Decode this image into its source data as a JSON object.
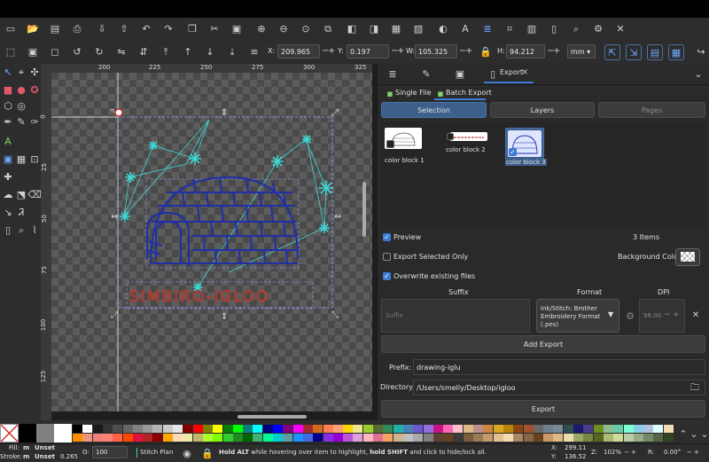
{
  "controls": {
    "x_label": "X:",
    "x_value": "209.965",
    "y_label": "Y:",
    "y_value": "0.197",
    "w_label": "W:",
    "w_value": "105.325",
    "h_label": "H:",
    "h_value": "94.212",
    "unit": "mm",
    "plus": "+",
    "minus": "−"
  },
  "ruler": {
    "h_ticks": [
      "200",
      "225",
      "250",
      "275",
      "300",
      "325"
    ],
    "v_ticks": [
      "0",
      "25",
      "50",
      "75",
      "100",
      "125"
    ]
  },
  "canvas": {
    "logo_text": "SIMBIRO-IGLOO"
  },
  "panel": {
    "tab_export": "Export",
    "tab_close": "×",
    "single_file": "Single File",
    "batch_export": "Batch Export",
    "seg_selection": "Selection",
    "seg_layers": "Layers",
    "seg_pages": "Pages",
    "items": [
      {
        "label": "color block 1"
      },
      {
        "label": "color block 2"
      },
      {
        "label": "color block 3"
      }
    ],
    "preview_label": "Preview",
    "items_count": "3 Items",
    "export_selected_label": "Export Selected Only",
    "background_color_label": "Background Color",
    "overwrite_label": "Overwrite existing files",
    "col_suffix": "Suffix",
    "col_format": "Format",
    "col_dpi": "DPI",
    "suffix_placeholder": "Suffix",
    "format_value": "Ink/Stitch: Brother Embroidery Format (.pes)",
    "dpi_value": "96.00",
    "add_export": "Add Export",
    "prefix_label": "Prefix:",
    "prefix_value": "drawing-iglu",
    "directory_label": "Directory:",
    "directory_value": "/Users/smelly/Desktop/igloo",
    "export_button": "Export"
  },
  "status": {
    "fill_label": "Fill:",
    "fill_m": "m",
    "fill_value": "Unset",
    "stroke_label": "Stroke:",
    "stroke_m": "m",
    "stroke_value": "Unset",
    "stroke_width": "0.265",
    "opacity_label": "O:",
    "opacity_value": "100",
    "layer_name": "Stitch Plan",
    "hint_bold1": "Hold ALT",
    "hint_mid": " while hovering over item to highlight, ",
    "hint_bold2": "hold SHIFT",
    "hint_end": " and click to hide/lock all.",
    "x_label": "X:",
    "x_value": "299.11",
    "y_label": "Y:",
    "y_value": "136.52",
    "zoom_label": "Z:",
    "zoom_value": "102%",
    "rot_label": "R:",
    "rot_value": "0.00°"
  },
  "colors": {
    "accent": "#3d5f8c",
    "igloo_stroke": "#1f2fa8",
    "snow_stroke": "#3fd6d6",
    "text_red": "#c0392b"
  },
  "palette_row1": [
    "#000000",
    "#ffffff",
    "#1a1a1a",
    "#333333",
    "#4d4d4d",
    "#666666",
    "#808080",
    "#999999",
    "#b3b3b3",
    "#cccccc",
    "#e6e6e6",
    "#800000",
    "#ff0000",
    "#808000",
    "#ffff00",
    "#008000",
    "#00ff00",
    "#008080",
    "#00ffff",
    "#000080",
    "#0000ff",
    "#800080",
    "#ff00ff",
    "#a52a2a",
    "#d2691e",
    "#ff7f50",
    "#ffa07a",
    "#ffd700",
    "#f0e68c",
    "#9acd32",
    "#556b2f",
    "#2e8b57",
    "#20b2aa",
    "#4682b4",
    "#6a5acd",
    "#9370db",
    "#c71585",
    "#ff69b4",
    "#ffc0cb",
    "#deb887",
    "#bc8f8f",
    "#cd853f",
    "#daa520",
    "#b8860b",
    "#8b4513",
    "#a0522d",
    "#696969",
    "#708090",
    "#778899",
    "#2f4f4f",
    "#191970",
    "#483d8b",
    "#6b8e23",
    "#8fbc8f",
    "#66cdaa",
    "#7fffd4",
    "#87ceeb",
    "#b0c4de",
    "#e0ffff",
    "#f5deb3"
  ],
  "palette_row2": [
    "#ff8c00",
    "#e9967a",
    "#f08080",
    "#fa8072",
    "#ff6347",
    "#ff4500",
    "#dc143c",
    "#b22222",
    "#8b0000",
    "#ffa500",
    "#ffdab9",
    "#eee8aa",
    "#bdb76b",
    "#adff2f",
    "#7cfc00",
    "#32cd32",
    "#228b22",
    "#006400",
    "#3cb371",
    "#00fa9a",
    "#00ced1",
    "#5f9ea0",
    "#1e90ff",
    "#4169e1",
    "#00008b",
    "#8a2be2",
    "#9400d3",
    "#ba55d3",
    "#dda0dd",
    "#ffb6c1",
    "#db7093",
    "#f4a460",
    "#d2b48c",
    "#c0c0c0",
    "#a9a9a9",
    "#808080",
    "#5c4033",
    "#654321",
    "#3b3b3b",
    "#7a5c3e",
    "#9c7a54",
    "#c49a6c",
    "#e3c18c",
    "#f2dcb3",
    "#aa8866",
    "#886644",
    "#664422",
    "#cc9966",
    "#ddbb88",
    "#eeddaa",
    "#99aa66",
    "#778844",
    "#556622",
    "#aabb77",
    "#ccdd99",
    "#bbccaa",
    "#99aa88",
    "#778866",
    "#556644",
    "#334422"
  ]
}
